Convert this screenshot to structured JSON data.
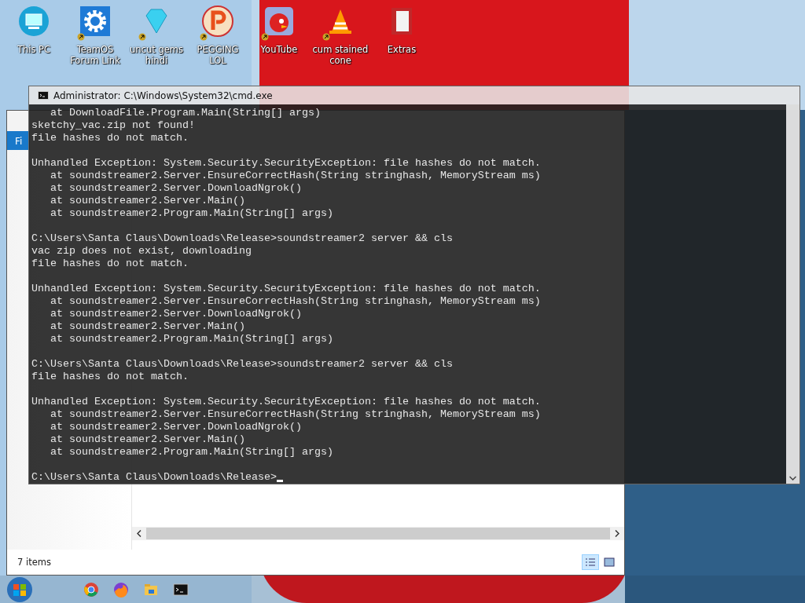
{
  "desktop_icons": [
    {
      "label": "This PC",
      "kind": "monitor",
      "shortcut": false
    },
    {
      "label": "TeamOS Forum Link",
      "kind": "gear",
      "shortcut": true
    },
    {
      "label": "uncut gems hindi",
      "kind": "gem",
      "shortcut": true
    },
    {
      "label": "PEGGING LOL",
      "kind": "letter",
      "shortcut": true
    },
    {
      "label": "YouTube",
      "kind": "bird",
      "shortcut": true
    },
    {
      "label": "cum stained cone",
      "kind": "cone",
      "shortcut": true
    },
    {
      "label": "Extras",
      "kind": "folder",
      "shortcut": false
    }
  ],
  "explorer": {
    "ribbon_tab": "Fi",
    "status_bar": "7 items",
    "view_buttons": [
      {
        "kind": "details",
        "selected": true
      },
      {
        "kind": "thumbnails",
        "selected": false
      }
    ]
  },
  "cmd": {
    "title": "Administrator: C:\\Windows\\System32\\cmd.exe",
    "cursor": true,
    "blocks": [
      [
        "   at DownloadFile.Program.Main(String[] args)",
        "sketchy_vac.zip not found!",
        "file hashes do not match."
      ],
      [
        "Unhandled Exception: System.Security.SecurityException: file hashes do not match.",
        "   at soundstreamer2.Server.EnsureCorrectHash(String stringhash, MemoryStream ms)",
        "   at soundstreamer2.Server.DownloadNgrok()",
        "   at soundstreamer2.Server.Main()",
        "   at soundstreamer2.Program.Main(String[] args)"
      ],
      [
        "C:\\Users\\Santa Claus\\Downloads\\Release>soundstreamer2 server && cls",
        "vac zip does not exist, downloading",
        "file hashes do not match."
      ],
      [
        "Unhandled Exception: System.Security.SecurityException: file hashes do not match.",
        "   at soundstreamer2.Server.EnsureCorrectHash(String stringhash, MemoryStream ms)",
        "   at soundstreamer2.Server.DownloadNgrok()",
        "   at soundstreamer2.Server.Main()",
        "   at soundstreamer2.Program.Main(String[] args)"
      ],
      [
        "C:\\Users\\Santa Claus\\Downloads\\Release>soundstreamer2 server && cls",
        "file hashes do not match."
      ],
      [
        "Unhandled Exception: System.Security.SecurityException: file hashes do not match.",
        "   at soundstreamer2.Server.EnsureCorrectHash(String stringhash, MemoryStream ms)",
        "   at soundstreamer2.Server.DownloadNgrok()",
        "   at soundstreamer2.Server.Main()",
        "   at soundstreamer2.Program.Main(String[] args)"
      ],
      [
        "C:\\Users\\Santa Claus\\Downloads\\Release>"
      ]
    ]
  },
  "taskbar": [
    {
      "kind": "browser-round"
    },
    {
      "kind": "fox"
    },
    {
      "kind": "folder"
    },
    {
      "kind": "console"
    }
  ]
}
